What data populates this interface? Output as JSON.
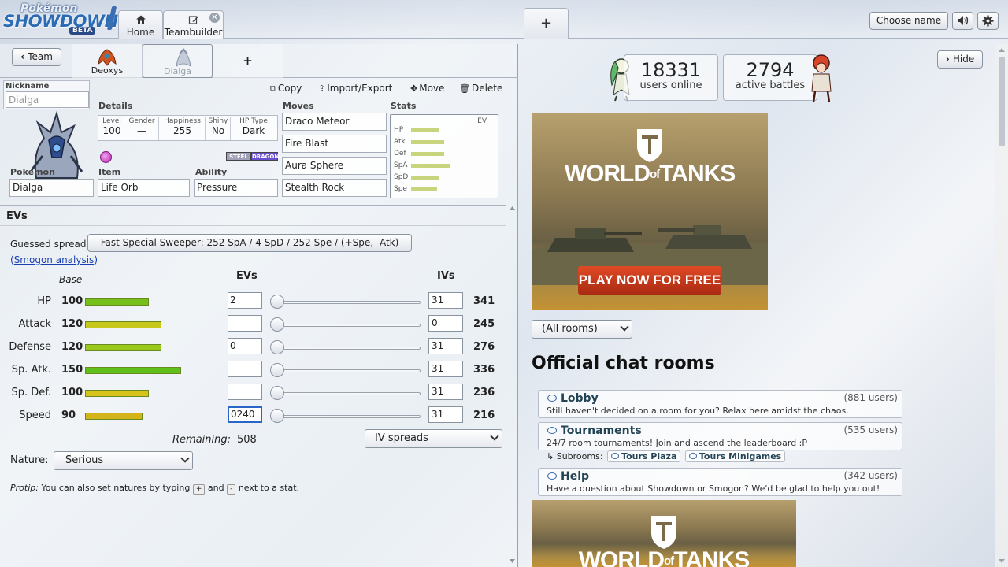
{
  "header": {
    "logo": {
      "line1": "Pokémon",
      "line2": "SHOWDOWN",
      "badge": "BETA"
    },
    "tabs": [
      {
        "label": "Home",
        "icon": "home-icon"
      },
      {
        "label": "Teambuilder",
        "icon": "edit-icon"
      }
    ],
    "new_tab_label": "+",
    "choose_name": "Choose name",
    "icons": [
      "volume-icon",
      "gear-icon"
    ]
  },
  "teambuilder": {
    "back_button": "Team",
    "mon_tabs": [
      "Deoxys",
      "Dialga"
    ],
    "add_button": "+",
    "actions": {
      "copy": "Copy",
      "import_export": "Import/Export",
      "move": "Move",
      "delete": "Delete"
    },
    "set": {
      "nickname_label": "Nickname",
      "nickname_placeholder": "Dialga",
      "details_label": "Details",
      "details": [
        {
          "label": "Level",
          "value": "100"
        },
        {
          "label": "Gender",
          "value": "—"
        },
        {
          "label": "Happiness",
          "value": "255"
        },
        {
          "label": "Shiny",
          "value": "No"
        },
        {
          "label": "HP Type",
          "value": "Dark"
        }
      ],
      "types": [
        "STEEL",
        "DRAGON"
      ],
      "pokemon_label": "Pokemon",
      "pokemon": "Dialga",
      "item_label": "Item",
      "item": "Life Orb",
      "ability_label": "Ability",
      "ability": "Pressure",
      "moves_label": "Moves",
      "moves": [
        "Draco Meteor",
        "Fire Blast",
        "Aura Sphere",
        "Stealth Rock"
      ],
      "stats_label": "Stats",
      "stats_ev_label": "EV",
      "stats": [
        {
          "name": "HP",
          "bar": 0.36
        },
        {
          "name": "Atk",
          "bar": 0.42
        },
        {
          "name": "Def",
          "bar": 0.42
        },
        {
          "name": "SpA",
          "bar": 0.5
        },
        {
          "name": "SpD",
          "bar": 0.36
        },
        {
          "name": "Spe",
          "bar": 0.33
        }
      ]
    },
    "evs": {
      "heading": "EVs",
      "guessed_label": "Guessed spread:",
      "guessed_spread": "Fast Special Sweeper: 252 SpA / 4 SpD / 252 Spe / (+Spe, -Atk)",
      "smogon_link": "Smogon analysis",
      "col_base": "Base",
      "col_evs": "EVs",
      "col_ivs": "IVs",
      "rows": [
        {
          "name": "HP",
          "base": "100",
          "ev": "2",
          "iv": "31",
          "total": "341",
          "bar_color": "#76c01b",
          "base_value": 100
        },
        {
          "name": "Attack",
          "base": "120",
          "ev": "",
          "iv": "0",
          "total": "245",
          "bar_color": "#c6c81b",
          "base_value": 120
        },
        {
          "name": "Defense",
          "base": "120",
          "ev": "0",
          "iv": "31",
          "total": "276",
          "bar_color": "#9ac81b",
          "base_value": 120
        },
        {
          "name": "Sp. Atk.",
          "base": "150",
          "ev": "",
          "iv": "31",
          "total": "336",
          "bar_color": "#5fc01b",
          "base_value": 150
        },
        {
          "name": "Sp. Def.",
          "base": "100",
          "ev": "",
          "iv": "31",
          "total": "236",
          "bar_color": "#d6c41b",
          "base_value": 100
        },
        {
          "name": "Speed",
          "base": "90",
          "ev": "0240",
          "iv": "31",
          "total": "216",
          "bar_color": "#d4b41b",
          "base_value": 90
        }
      ],
      "remaining_label": "Remaining:",
      "remaining": "508",
      "iv_spreads": "IV spreads",
      "nature_label": "Nature:",
      "nature": "Serious",
      "protip_label": "Protip:",
      "protip_text": "You can also set natures by typing",
      "protip_plus": "+",
      "protip_and": "and",
      "protip_minus": "-",
      "protip_end": "next to a stat."
    }
  },
  "home": {
    "hide_button": "Hide",
    "users_online": {
      "count": "18331",
      "label": "users online"
    },
    "active_battles": {
      "count": "2794",
      "label": "active battles"
    },
    "ad": {
      "brand_line1": "WORLD",
      "brand_of": "of",
      "brand_line2": "TANKS",
      "cta": "PLAY NOW FOR FREE"
    },
    "room_filter": "(All rooms)",
    "rooms_heading": "Official chat rooms",
    "rooms": [
      {
        "name": "Lobby",
        "users": "(881 users)",
        "desc": "Still haven't decided on a room for you? Relax here amidst the chaos."
      },
      {
        "name": "Tournaments",
        "users": "(535 users)",
        "desc": "24/7 room tournaments! Join and ascend the leaderboard :P"
      },
      {
        "name": "Help",
        "users": "(342 users)",
        "desc": "Have a question about Showdown or Smogon? We'd be glad to help you out!"
      }
    ],
    "subrooms_label": "Subrooms:",
    "subrooms": [
      "Tours Plaza",
      "Tours Minigames"
    ]
  },
  "colors": {
    "accent": "#2b6cb5",
    "link": "#1a3fb0",
    "stat_bar": "#c9d47e",
    "steel_type": "#a0a0b8",
    "dragon_type": "#6a50d0"
  }
}
